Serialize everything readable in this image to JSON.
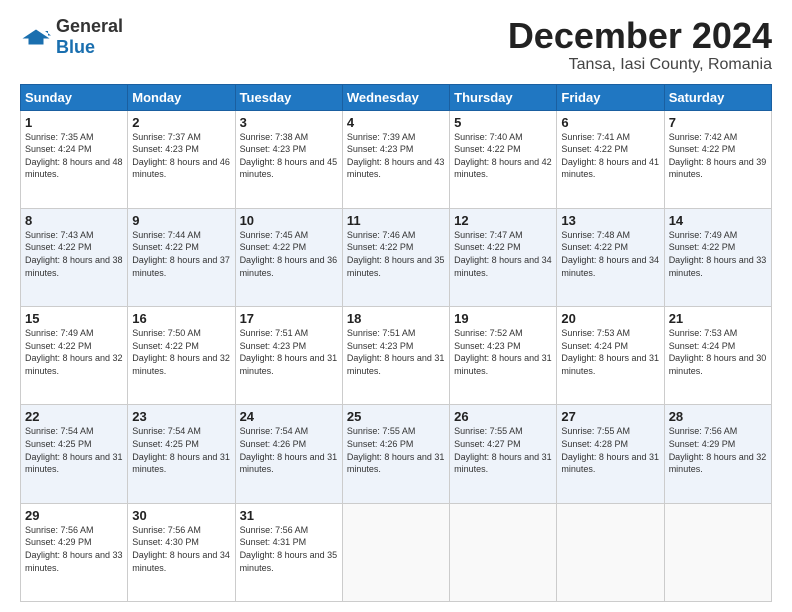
{
  "header": {
    "logo_line1": "General",
    "logo_line2": "Blue",
    "month": "December 2024",
    "location": "Tansa, Iasi County, Romania"
  },
  "days_of_week": [
    "Sunday",
    "Monday",
    "Tuesday",
    "Wednesday",
    "Thursday",
    "Friday",
    "Saturday"
  ],
  "weeks": [
    [
      {
        "day": 1,
        "sunrise": "7:35 AM",
        "sunset": "4:24 PM",
        "daylight": "8 hours and 48 minutes."
      },
      {
        "day": 2,
        "sunrise": "7:37 AM",
        "sunset": "4:23 PM",
        "daylight": "8 hours and 46 minutes."
      },
      {
        "day": 3,
        "sunrise": "7:38 AM",
        "sunset": "4:23 PM",
        "daylight": "8 hours and 45 minutes."
      },
      {
        "day": 4,
        "sunrise": "7:39 AM",
        "sunset": "4:23 PM",
        "daylight": "8 hours and 43 minutes."
      },
      {
        "day": 5,
        "sunrise": "7:40 AM",
        "sunset": "4:22 PM",
        "daylight": "8 hours and 42 minutes."
      },
      {
        "day": 6,
        "sunrise": "7:41 AM",
        "sunset": "4:22 PM",
        "daylight": "8 hours and 41 minutes."
      },
      {
        "day": 7,
        "sunrise": "7:42 AM",
        "sunset": "4:22 PM",
        "daylight": "8 hours and 39 minutes."
      }
    ],
    [
      {
        "day": 8,
        "sunrise": "7:43 AM",
        "sunset": "4:22 PM",
        "daylight": "8 hours and 38 minutes."
      },
      {
        "day": 9,
        "sunrise": "7:44 AM",
        "sunset": "4:22 PM",
        "daylight": "8 hours and 37 minutes."
      },
      {
        "day": 10,
        "sunrise": "7:45 AM",
        "sunset": "4:22 PM",
        "daylight": "8 hours and 36 minutes."
      },
      {
        "day": 11,
        "sunrise": "7:46 AM",
        "sunset": "4:22 PM",
        "daylight": "8 hours and 35 minutes."
      },
      {
        "day": 12,
        "sunrise": "7:47 AM",
        "sunset": "4:22 PM",
        "daylight": "8 hours and 34 minutes."
      },
      {
        "day": 13,
        "sunrise": "7:48 AM",
        "sunset": "4:22 PM",
        "daylight": "8 hours and 34 minutes."
      },
      {
        "day": 14,
        "sunrise": "7:49 AM",
        "sunset": "4:22 PM",
        "daylight": "8 hours and 33 minutes."
      }
    ],
    [
      {
        "day": 15,
        "sunrise": "7:49 AM",
        "sunset": "4:22 PM",
        "daylight": "8 hours and 32 minutes."
      },
      {
        "day": 16,
        "sunrise": "7:50 AM",
        "sunset": "4:22 PM",
        "daylight": "8 hours and 32 minutes."
      },
      {
        "day": 17,
        "sunrise": "7:51 AM",
        "sunset": "4:23 PM",
        "daylight": "8 hours and 31 minutes."
      },
      {
        "day": 18,
        "sunrise": "7:51 AM",
        "sunset": "4:23 PM",
        "daylight": "8 hours and 31 minutes."
      },
      {
        "day": 19,
        "sunrise": "7:52 AM",
        "sunset": "4:23 PM",
        "daylight": "8 hours and 31 minutes."
      },
      {
        "day": 20,
        "sunrise": "7:53 AM",
        "sunset": "4:24 PM",
        "daylight": "8 hours and 31 minutes."
      },
      {
        "day": 21,
        "sunrise": "7:53 AM",
        "sunset": "4:24 PM",
        "daylight": "8 hours and 30 minutes."
      }
    ],
    [
      {
        "day": 22,
        "sunrise": "7:54 AM",
        "sunset": "4:25 PM",
        "daylight": "8 hours and 31 minutes."
      },
      {
        "day": 23,
        "sunrise": "7:54 AM",
        "sunset": "4:25 PM",
        "daylight": "8 hours and 31 minutes."
      },
      {
        "day": 24,
        "sunrise": "7:54 AM",
        "sunset": "4:26 PM",
        "daylight": "8 hours and 31 minutes."
      },
      {
        "day": 25,
        "sunrise": "7:55 AM",
        "sunset": "4:26 PM",
        "daylight": "8 hours and 31 minutes."
      },
      {
        "day": 26,
        "sunrise": "7:55 AM",
        "sunset": "4:27 PM",
        "daylight": "8 hours and 31 minutes."
      },
      {
        "day": 27,
        "sunrise": "7:55 AM",
        "sunset": "4:28 PM",
        "daylight": "8 hours and 31 minutes."
      },
      {
        "day": 28,
        "sunrise": "7:56 AM",
        "sunset": "4:29 PM",
        "daylight": "8 hours and 32 minutes."
      }
    ],
    [
      {
        "day": 29,
        "sunrise": "7:56 AM",
        "sunset": "4:29 PM",
        "daylight": "8 hours and 33 minutes."
      },
      {
        "day": 30,
        "sunrise": "7:56 AM",
        "sunset": "4:30 PM",
        "daylight": "8 hours and 34 minutes."
      },
      {
        "day": 31,
        "sunrise": "7:56 AM",
        "sunset": "4:31 PM",
        "daylight": "8 hours and 35 minutes."
      },
      null,
      null,
      null,
      null
    ]
  ]
}
